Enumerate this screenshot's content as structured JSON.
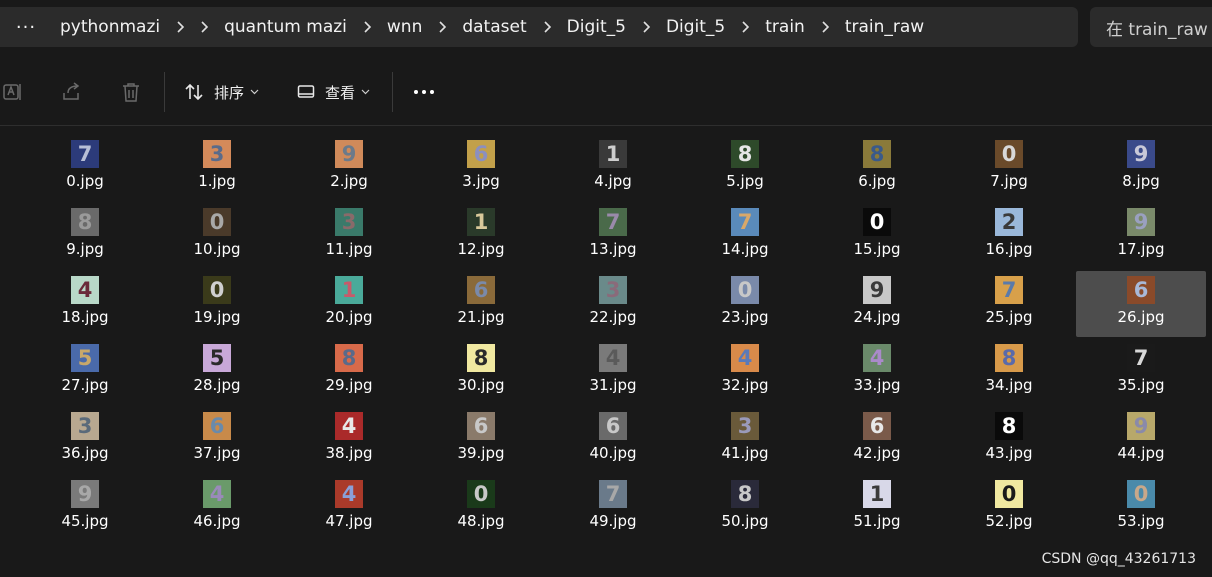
{
  "breadcrumb": [
    "pythonmazi",
    "quantum mazi",
    "wnn",
    "dataset",
    "Digit_5",
    "Digit_5",
    "train",
    "train_raw"
  ],
  "search": {
    "placeholder": "在 train_raw 中"
  },
  "toolbar": {
    "sort_label": "排序",
    "view_label": "查看"
  },
  "watermark": "CSDN @qq_43261713",
  "selected_file": "26.jpg",
  "files": [
    {
      "name": "0.jpg",
      "digit": "7",
      "bg": "#2c3b7a",
      "fg": "#b8bfd6"
    },
    {
      "name": "1.jpg",
      "digit": "3",
      "bg": "#d48a5a",
      "fg": "#5a6b8a"
    },
    {
      "name": "2.jpg",
      "digit": "9",
      "bg": "#d08a5a",
      "fg": "#6b7a8a"
    },
    {
      "name": "3.jpg",
      "digit": "6",
      "bg": "#c2a04a",
      "fg": "#8b8fbf"
    },
    {
      "name": "4.jpg",
      "digit": "1",
      "bg": "#3a3a3a",
      "fg": "#cfcfcf"
    },
    {
      "name": "5.jpg",
      "digit": "8",
      "bg": "#2e4a2a",
      "fg": "#e6e6e6"
    },
    {
      "name": "6.jpg",
      "digit": "8",
      "bg": "#8a7a3a",
      "fg": "#3a5a8a"
    },
    {
      "name": "7.jpg",
      "digit": "0",
      "bg": "#6a4a2a",
      "fg": "#d8d8d8"
    },
    {
      "name": "8.jpg",
      "digit": "9",
      "bg": "#3a4a8a",
      "fg": "#c8c8d8"
    },
    {
      "name": "9.jpg",
      "digit": "8",
      "bg": "#6a6a6a",
      "fg": "#9a9a9a"
    },
    {
      "name": "10.jpg",
      "digit": "0",
      "bg": "#4a3a2a",
      "fg": "#a8a8a8"
    },
    {
      "name": "11.jpg",
      "digit": "3",
      "bg": "#3a7a6a",
      "fg": "#8a6a6a"
    },
    {
      "name": "12.jpg",
      "digit": "1",
      "bg": "#2a3a2a",
      "fg": "#d8c89a"
    },
    {
      "name": "13.jpg",
      "digit": "7",
      "bg": "#4a6a4a",
      "fg": "#9a8aaa"
    },
    {
      "name": "14.jpg",
      "digit": "7",
      "bg": "#5a8aba",
      "fg": "#d8a86a"
    },
    {
      "name": "15.jpg",
      "digit": "0",
      "bg": "#0a0a0a",
      "fg": "#ffffff"
    },
    {
      "name": "16.jpg",
      "digit": "2",
      "bg": "#9ab8da",
      "fg": "#3a3a3a"
    },
    {
      "name": "17.jpg",
      "digit": "9",
      "bg": "#7a8a6a",
      "fg": "#9aa0c0"
    },
    {
      "name": "18.jpg",
      "digit": "4",
      "bg": "#b8d8c8",
      "fg": "#6a2a3a"
    },
    {
      "name": "19.jpg",
      "digit": "0",
      "bg": "#3a3a1a",
      "fg": "#cfcfcf"
    },
    {
      "name": "20.jpg",
      "digit": "1",
      "bg": "#4aaa9a",
      "fg": "#c85a6a"
    },
    {
      "name": "21.jpg",
      "digit": "6",
      "bg": "#8a6a3a",
      "fg": "#7a8aaa"
    },
    {
      "name": "22.jpg",
      "digit": "3",
      "bg": "#6a8a8a",
      "fg": "#8a6a7a"
    },
    {
      "name": "23.jpg",
      "digit": "0",
      "bg": "#7a8aaa",
      "fg": "#c8c8c8"
    },
    {
      "name": "24.jpg",
      "digit": "9",
      "bg": "#c8c8c8",
      "fg": "#3a3a3a"
    },
    {
      "name": "25.jpg",
      "digit": "7",
      "bg": "#d8a04a",
      "fg": "#5a7aaa"
    },
    {
      "name": "26.jpg",
      "digit": "6",
      "bg": "#8a4a2a",
      "fg": "#a8b8d8"
    },
    {
      "name": "27.jpg",
      "digit": "5",
      "bg": "#4a6aaa",
      "fg": "#c8a86a"
    },
    {
      "name": "28.jpg",
      "digit": "5",
      "bg": "#c8a8d8",
      "fg": "#2a2a2a"
    },
    {
      "name": "29.jpg",
      "digit": "8",
      "bg": "#d86a4a",
      "fg": "#5a6a8a"
    },
    {
      "name": "30.jpg",
      "digit": "8",
      "bg": "#f0e8a0",
      "fg": "#2a2a2a"
    },
    {
      "name": "31.jpg",
      "digit": "4",
      "bg": "#7a7a7a",
      "fg": "#5a5a5a"
    },
    {
      "name": "32.jpg",
      "digit": "4",
      "bg": "#d88a4a",
      "fg": "#5a7aba"
    },
    {
      "name": "33.jpg",
      "digit": "4",
      "bg": "#6a8a6a",
      "fg": "#aa8aca"
    },
    {
      "name": "34.jpg",
      "digit": "8",
      "bg": "#d89a4a",
      "fg": "#5a6aaa"
    },
    {
      "name": "35.jpg",
      "digit": "7",
      "bg": "#1a1a1a",
      "fg": "#d8d8d8"
    },
    {
      "name": "36.jpg",
      "digit": "3",
      "bg": "#b8a890",
      "fg": "#5a6a7a"
    },
    {
      "name": "37.jpg",
      "digit": "6",
      "bg": "#c88a4a",
      "fg": "#6a8aaa"
    },
    {
      "name": "38.jpg",
      "digit": "4",
      "bg": "#aa2a2a",
      "fg": "#e8e8e8"
    },
    {
      "name": "39.jpg",
      "digit": "6",
      "bg": "#8a7a6a",
      "fg": "#c8c8c8"
    },
    {
      "name": "40.jpg",
      "digit": "6",
      "bg": "#6a6a6a",
      "fg": "#c8c8c8"
    },
    {
      "name": "41.jpg",
      "digit": "3",
      "bg": "#6a5a3a",
      "fg": "#9a9aba"
    },
    {
      "name": "42.jpg",
      "digit": "6",
      "bg": "#7a5a4a",
      "fg": "#e8e8e8"
    },
    {
      "name": "43.jpg",
      "digit": "8",
      "bg": "#0a0a0a",
      "fg": "#ffffff"
    },
    {
      "name": "44.jpg",
      "digit": "9",
      "bg": "#b8a86a",
      "fg": "#8a8aaa"
    },
    {
      "name": "45.jpg",
      "digit": "9",
      "bg": "#7a7a7a",
      "fg": "#a8a8a8"
    },
    {
      "name": "46.jpg",
      "digit": "4",
      "bg": "#6a9a6a",
      "fg": "#9a8aba"
    },
    {
      "name": "47.jpg",
      "digit": "4",
      "bg": "#aa3a2a",
      "fg": "#8aa0d8"
    },
    {
      "name": "48.jpg",
      "digit": "0",
      "bg": "#1a3a1a",
      "fg": "#c8c8c8"
    },
    {
      "name": "49.jpg",
      "digit": "7",
      "bg": "#6a7a8a",
      "fg": "#a8a8a8"
    },
    {
      "name": "50.jpg",
      "digit": "8",
      "bg": "#2a2a3a",
      "fg": "#c8c8c8"
    },
    {
      "name": "51.jpg",
      "digit": "1",
      "bg": "#d8d8e8",
      "fg": "#3a3a3a"
    },
    {
      "name": "52.jpg",
      "digit": "0",
      "bg": "#f0e8a0",
      "fg": "#1a1a1a"
    },
    {
      "name": "53.jpg",
      "digit": "0",
      "bg": "#4a8aaa",
      "fg": "#c8a88a"
    }
  ]
}
